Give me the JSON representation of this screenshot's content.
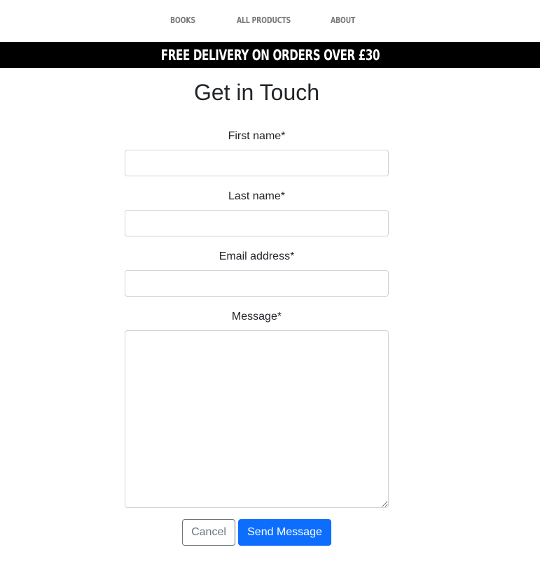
{
  "nav": {
    "items": [
      {
        "label": "BOOKS"
      },
      {
        "label": "ALL PRODUCTS"
      },
      {
        "label": "ABOUT"
      }
    ]
  },
  "banner": {
    "text": "FREE DELIVERY ON ORDERS OVER £30"
  },
  "form": {
    "title": "Get in Touch",
    "fields": [
      {
        "label": "First name*",
        "value": ""
      },
      {
        "label": "Last name*",
        "value": ""
      },
      {
        "label": "Email address*",
        "value": ""
      },
      {
        "label": "Message*",
        "value": ""
      }
    ],
    "cancel_label": "Cancel",
    "submit_label": "Send Message"
  },
  "colors": {
    "banner_bg": "#000000",
    "primary": "#0d6efd",
    "secondary": "#6c757d"
  }
}
